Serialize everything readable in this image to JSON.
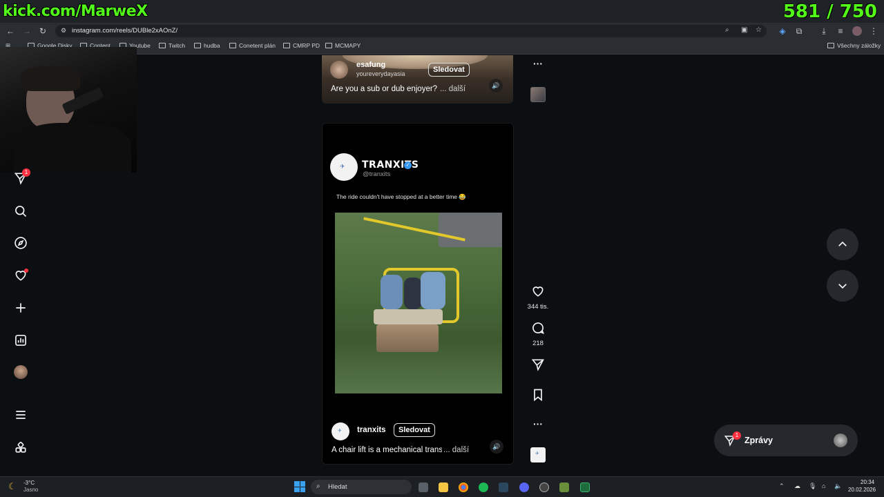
{
  "overlay": {
    "kick_channel": "kick.com/MarweX",
    "counter": "581 / 750"
  },
  "browser": {
    "url": "instagram.com/reels/DUBle2xAOnZ/",
    "bookmarks": [
      "Google Disky",
      "Content",
      "Youtube",
      "Twitch",
      "hudba",
      "Conetent plán",
      "CMRP PD",
      "MCMAPY"
    ],
    "all_bookmarks": "Všechny záložky"
  },
  "sidebar": {
    "notifications_badge": "1"
  },
  "previous_reel": {
    "username": "esafung",
    "audio": "youreverydayasia",
    "follow_label": "Sledovat",
    "caption": "Are you a sub or dub enjoyer?",
    "more": "... další"
  },
  "reel": {
    "embed_brand": "TRANXITS",
    "embed_handle": "@tranxits",
    "embed_caption": "The ride couldn't have stopped at a better time 😂",
    "username": "tranxits",
    "follow_label": "Sledovat",
    "caption": "A chair lift is a mechanical trans",
    "more": "... další",
    "likes": "344 tis.",
    "comments": "218"
  },
  "messages": {
    "label": "Zprávy",
    "badge": "1"
  },
  "taskbar": {
    "weather_temp": "-3°C",
    "weather_desc": "Jasno",
    "search_placeholder": "Hledat",
    "time": "20:34",
    "date": "20.02.2026"
  },
  "colors": {
    "kick_green": "#53fc18",
    "instagram_red": "#ff3040",
    "verified_blue": "#3897f0"
  }
}
